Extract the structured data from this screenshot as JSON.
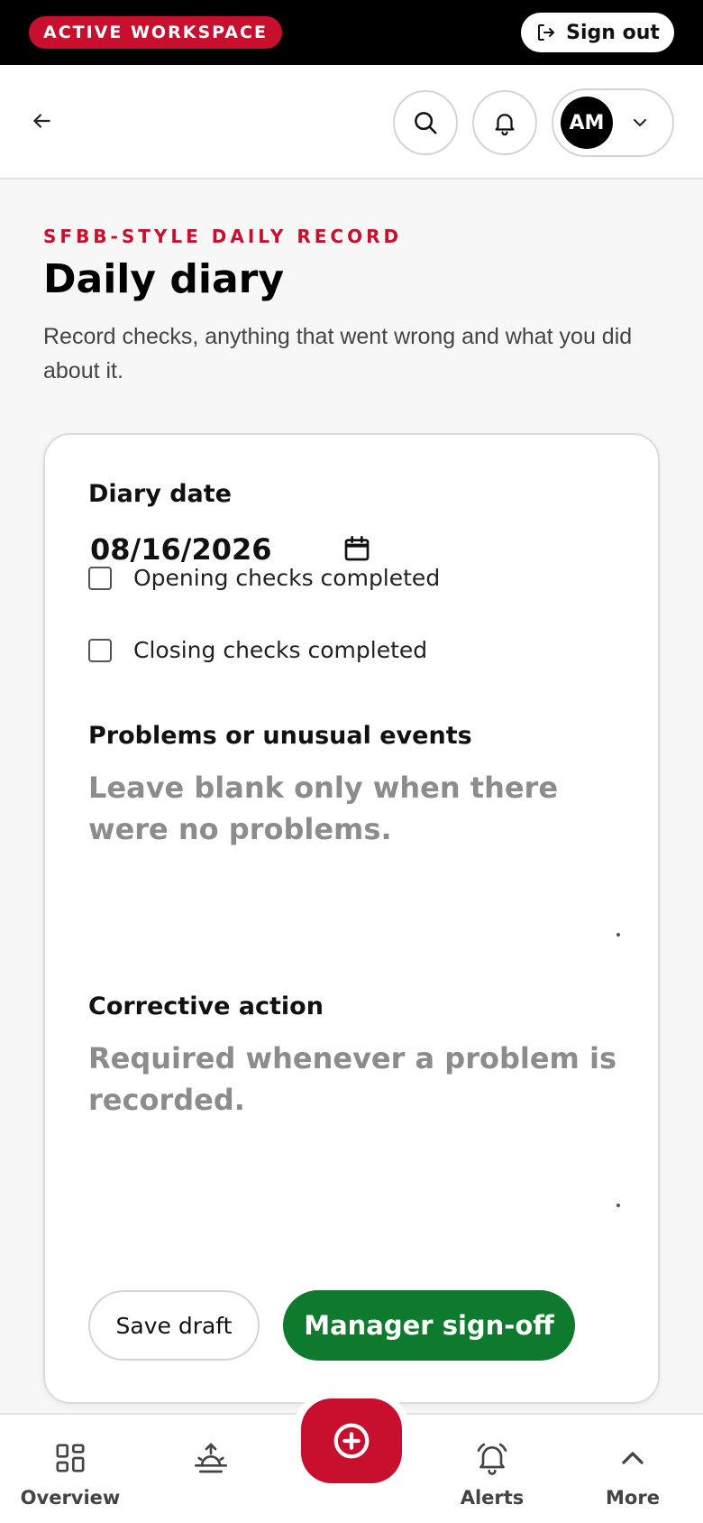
{
  "topbar": {
    "workspace_badge": "ACTIVE WORKSPACE",
    "signout_label": "Sign out",
    "signout_icon": "sign-out-icon"
  },
  "header": {
    "back_icon": "arrow-left-icon",
    "search_icon": "search-icon",
    "bell_icon": "bell-icon",
    "avatar_initials": "AM",
    "account_chevron": "chevron-down-icon"
  },
  "page": {
    "eyebrow": "SFBB-STYLE DAILY RECORD",
    "title": "Daily diary",
    "subtitle": "Record checks, anything that went wrong and what you did about it."
  },
  "form": {
    "date_label": "Diary date",
    "date_value": "08/16/2026",
    "opening_check_label": "Opening checks completed",
    "opening_checked": false,
    "closing_check_label": "Closing checks completed",
    "closing_checked": false,
    "problems_label": "Problems or unusual events",
    "problems_placeholder": "Leave blank only when there were no problems.",
    "corrective_label": "Corrective action",
    "corrective_placeholder": "Required whenever a problem is recorded.",
    "save_draft_label": "Save draft",
    "signoff_label": "Manager sign-off"
  },
  "bottom_nav": {
    "items": [
      {
        "label": "Overview",
        "icon": "grid-icon"
      },
      {
        "label": "",
        "icon": "sunrise-icon"
      },
      {
        "label": "",
        "icon": "plus-circle-icon"
      },
      {
        "label": "Alerts",
        "icon": "alarm-bell-icon"
      },
      {
        "label": "More",
        "icon": "chevron-up-icon"
      }
    ]
  },
  "colors": {
    "brand_red": "#c8102e",
    "signoff_green": "#0e7a2e",
    "topbar_black": "#000000"
  }
}
